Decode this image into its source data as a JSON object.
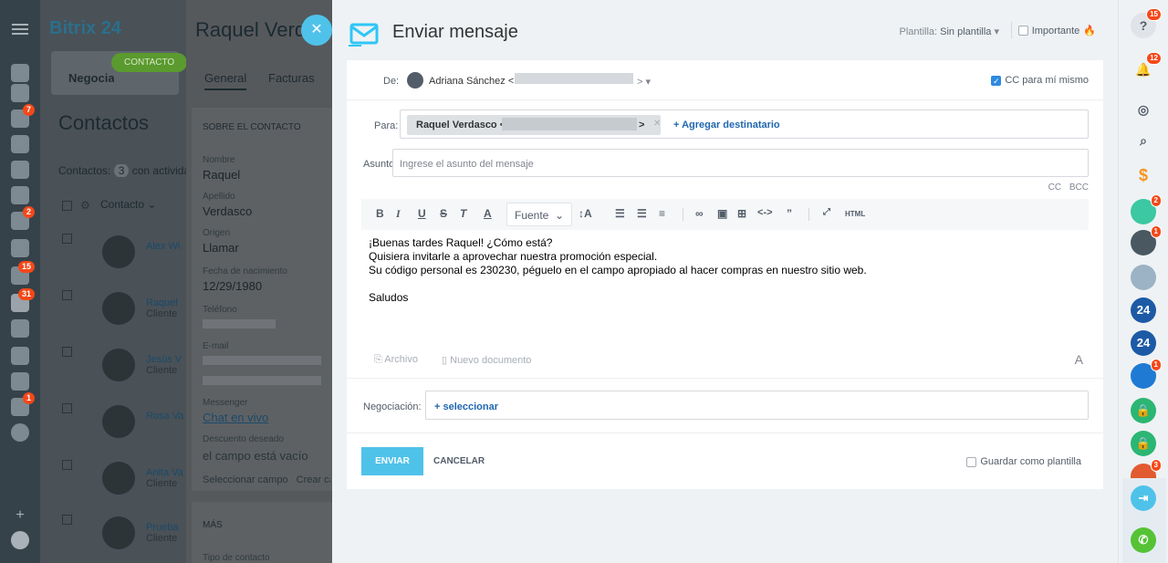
{
  "app": {
    "brand_name": "Bitrix",
    "brand_num": "24"
  },
  "left_sidebar": {
    "badges": [
      "7",
      "2",
      "15",
      "31",
      "1"
    ]
  },
  "crm": {
    "tab_label": "Negociaciones",
    "contact_pill": "CONTACTO",
    "title": "Contactos",
    "count_label": "Contactos:",
    "count_value": "3",
    "count_suffix": "con actividades",
    "column_header": "Contacto",
    "rows": [
      {
        "name": "Alex Wi",
        "sub": ""
      },
      {
        "name": "Raquel",
        "sub": "Cliente"
      },
      {
        "name": "Jesús V",
        "sub": "Cliente"
      },
      {
        "name": "Rosa Va",
        "sub": ""
      },
      {
        "name": "Anita Va",
        "sub": "Cliente"
      },
      {
        "name": "Prueba",
        "sub": "Cliente"
      }
    ]
  },
  "contact_panel": {
    "title": "Raquel Verdasco",
    "tabs": [
      "General",
      "Facturas"
    ],
    "section": "SOBRE EL CONTACTO",
    "fields": [
      {
        "label": "Nombre",
        "value": "Raquel"
      },
      {
        "label": "Apellido",
        "value": "Verdasco"
      },
      {
        "label": "Origen",
        "value": "Llamar"
      },
      {
        "label": "Fecha de nacimiento",
        "value": "12/29/1980"
      },
      {
        "label": "Teléfono",
        "value": ""
      },
      {
        "label": "E-mail",
        "value": ""
      },
      {
        "label": "Messenger",
        "value": "Chat en vivo"
      },
      {
        "label": "Descuento deseado",
        "value": "el campo está vacío"
      }
    ],
    "select_field": "Seleccionar campo",
    "create_field": "Crear campo",
    "more": "MÁS",
    "contact_type": "Tipo de contacto"
  },
  "modal": {
    "title": "Enviar mensaje",
    "template_label": "Plantilla:",
    "template_value": "Sin plantilla",
    "important_label": "Importante",
    "from_label": "De:",
    "from_name": "Adriana Sánchez <",
    "from_close": "> ▾",
    "cc_self_label": "CC para mí mismo",
    "to_label": "Para:",
    "to_recipient": "Raquel Verdasco <",
    "to_close": ">",
    "add_recipient": "+ Agregar destinatario",
    "subject_label": "Asunto:",
    "subject_placeholder": "Ingrese el asunto del mensaje",
    "cc": "CC",
    "bcc": "BCC",
    "font_select": "Fuente",
    "html_btn": "HTML",
    "body_lines": [
      "¡Buenas tardes Raquel! ¿Cómo está?",
      "Quisiera invitarle a aprovechar nuestra promoción especial.",
      "Su código personal es 230230, péguelo en el campo apropiado al hacer compras en nuestro sitio web.",
      "",
      "Saludos"
    ],
    "attach_file": "Archivo",
    "new_document": "Nuevo documento",
    "deal_label": "Negociación:",
    "deal_link": "+ seleccionar",
    "send": "ENVIAR",
    "cancel": "CANCELAR",
    "save_template": "Guardar como plantilla"
  },
  "right_sidebar": {
    "help_badge": "15",
    "bell_badge": "12",
    "b24": "24",
    "badges": [
      "2",
      "1",
      "1",
      "3"
    ]
  }
}
